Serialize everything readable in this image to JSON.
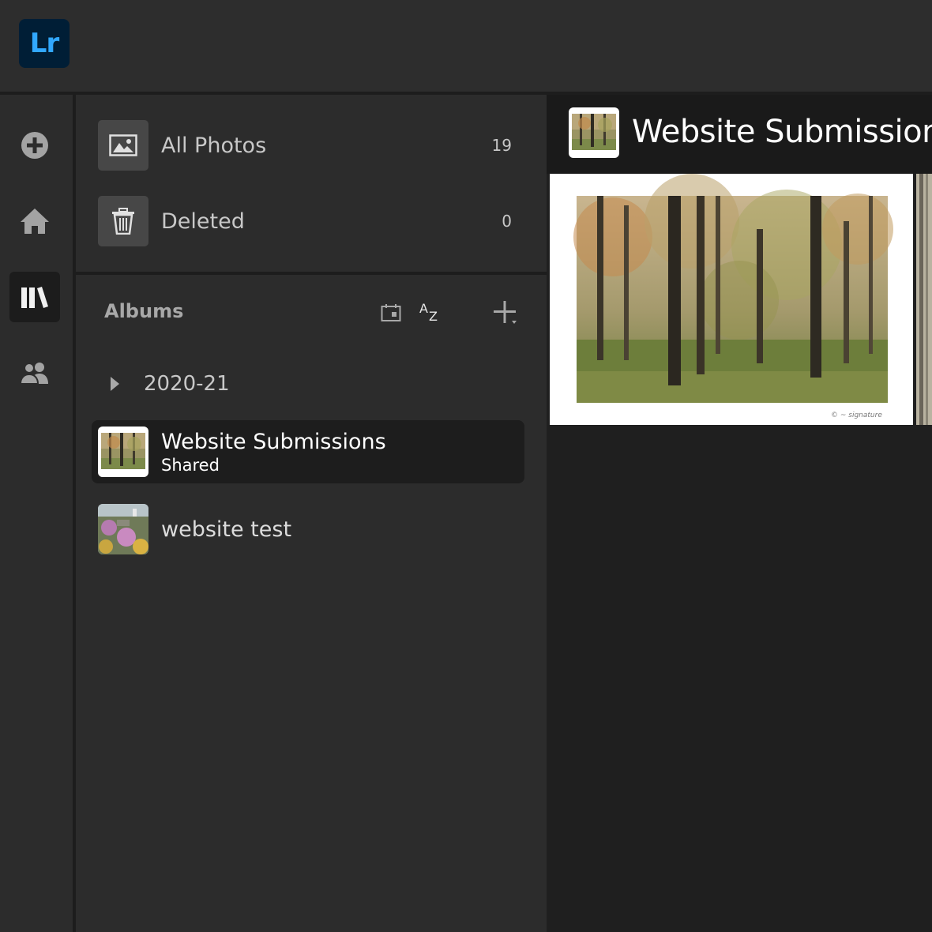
{
  "app": {
    "logo_text": "Lr",
    "logo_bg": "#001e36",
    "logo_fg": "#31a8ff"
  },
  "rail": {
    "items": [
      {
        "name": "add-photos",
        "icon": "plus-circle-icon"
      },
      {
        "name": "home",
        "icon": "home-icon"
      },
      {
        "name": "library",
        "icon": "library-icon",
        "active": true
      },
      {
        "name": "shared",
        "icon": "people-icon"
      }
    ]
  },
  "sources": {
    "all_photos": {
      "label": "All Photos",
      "count": "19",
      "icon": "photos-icon"
    },
    "deleted": {
      "label": "Deleted",
      "count": "0",
      "icon": "trash-icon"
    }
  },
  "albums": {
    "header": "Albums",
    "sort_label": "AZ",
    "folder": {
      "label": "2020-21"
    },
    "items": [
      {
        "name": "Website Submissions",
        "subtitle": "Shared",
        "selected": true
      },
      {
        "name": "website test",
        "subtitle": ""
      }
    ]
  },
  "main": {
    "title": "Website Submissions"
  }
}
